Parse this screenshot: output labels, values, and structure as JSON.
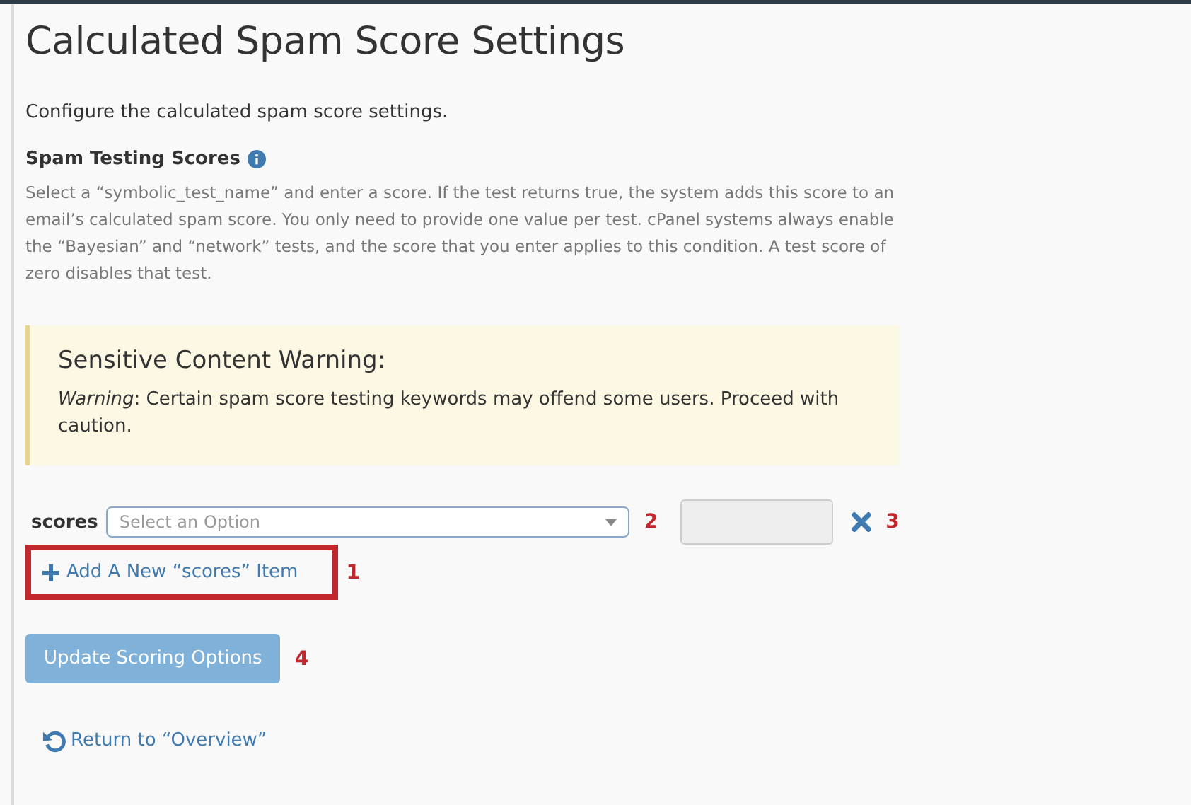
{
  "page": {
    "title": "Calculated Spam Score Settings",
    "description": "Configure the calculated spam score settings."
  },
  "section": {
    "heading": "Spam Testing Scores",
    "info_icon": true,
    "help": "Select a “symbolic_test_name” and enter a score. If the test returns true, the system adds this score to an email’s calculated spam score. You only need to provide one value per test. cPanel systems always enable the “Bayesian” and “network” tests, and the score that you enter applies to this condition. A test score of zero disables that test."
  },
  "warning": {
    "title": "Sensitive Content Warning:",
    "text": "*Warning*: Certain spam score testing keywords may offend some users. Proceed with caution."
  },
  "scores_row": {
    "label": "scores",
    "select": {
      "placeholder": "Select an Option"
    },
    "select_marker": "2",
    "remove_marker": "3"
  },
  "add_link": {
    "label": "Add A New “scores” Item",
    "highlighted": true,
    "marker": "1"
  },
  "submit": {
    "label": "Update Scoring Options",
    "disabled": true,
    "marker": "4"
  },
  "return_link": {
    "label": "Return to “Overview”"
  }
}
